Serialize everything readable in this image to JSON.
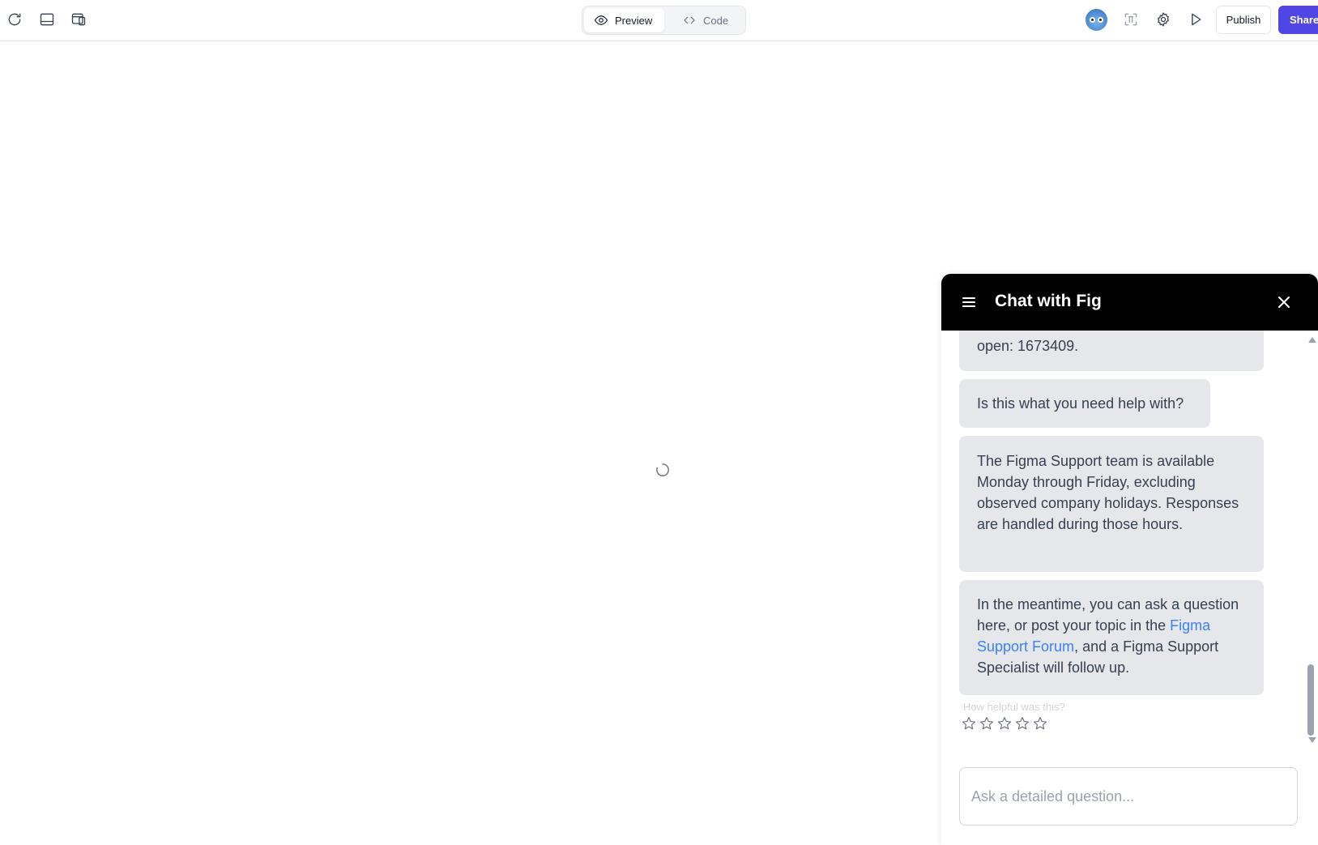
{
  "toolbar": {
    "left_icons": [
      "refresh-icon",
      "panel-layout-icon",
      "responsive-layout-icon"
    ],
    "view_tabs": {
      "preview_label": "Preview",
      "code_label": "Code",
      "active": "Preview"
    },
    "right_icons": [
      "avatar",
      "frame-icon",
      "gear-icon",
      "play-icon"
    ],
    "publish_label": "Publish",
    "share_label": "Share",
    "accent_color": "#4f46e5"
  },
  "canvas": {
    "state_icon": "loading-spinner-icon"
  },
  "chat": {
    "title": "Chat with Fig",
    "messages": [
      {
        "text": "open: 1673409."
      },
      {
        "text": "Is this what you need help with?"
      },
      {
        "text": "The Figma Support team is available Monday through Friday, excluding observed company holidays. Responses are handled during those hours."
      },
      {
        "text_before": "In the meantime, you can ask a question here, or post your topic in the ",
        "link": "Figma Support Forum",
        "text_after": ", and a Figma Support Specialist will follow up."
      }
    ],
    "rating_label": "How helpful was this?",
    "rating_max": 5,
    "input_placeholder": "Ask a detailed question...",
    "link_color": "#3b82f6"
  }
}
